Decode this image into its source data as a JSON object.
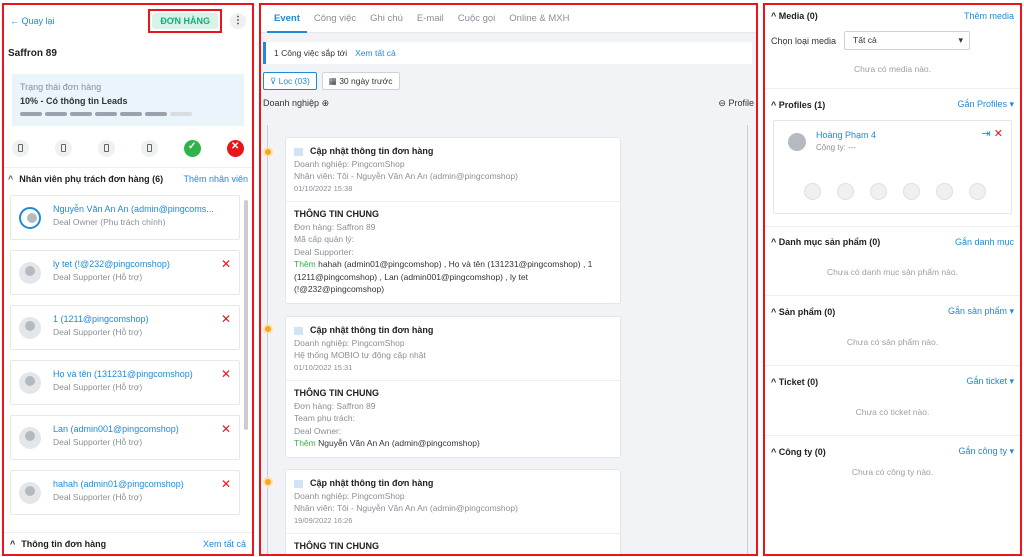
{
  "left": {
    "back": "← Quay lại",
    "badge": "ĐƠN HÀNG",
    "more": "⋮",
    "name": "Saffron 89",
    "status_label": "Trạng thái đơn hàng",
    "status_value": "10% - Có thông tin Leads",
    "staff_title": "Nhân viên phụ trách đơn hàng (6)",
    "staff_add": "Thêm nhân viên",
    "staff": [
      {
        "name": "Nguyễn Văn An An (admin@pingcoms...",
        "role": "Deal Owner (Phụ trách chính)"
      },
      {
        "name": "ly tet (!@232@pingcomshop)",
        "role": "Deal Supporter (Hỗ trợ)"
      },
      {
        "name": "1 (1211@pingcomshop)",
        "role": "Deal Supporter (Hỗ trợ)"
      },
      {
        "name": "Họ và tên (131231@pingcomshop)",
        "role": "Deal Supporter (Hỗ trợ)"
      },
      {
        "name": "Lan (admin001@pingcomshop)",
        "role": "Deal Supporter (Hỗ trợ)"
      },
      {
        "name": "hahah (admin01@pingcomshop)",
        "role": "Deal Supporter (Hỗ trợ)"
      }
    ],
    "order_info": "Thông tin đơn hàng",
    "view_all": "Xem tất cả"
  },
  "mid": {
    "tabs": [
      "Event",
      "Công việc",
      "Ghi chú",
      "E-mail",
      "Cuộc gọi",
      "Online & MXH"
    ],
    "upcoming": "1 Công việc sắp tới",
    "upcoming_link": "Xem tất cả",
    "filter": "Lọc (03)",
    "range": "30 ngày trước",
    "business": "Doanh nghiệp",
    "profile": "Profile",
    "cards": [
      {
        "title": "Cập nhật thông tin đơn hàng",
        "biz": "Doanh nghiệp:  PingcomShop",
        "who": "Nhân viên: Tôi - Nguyễn Văn An An (admin@pingcomshop)",
        "date": "01/10/2022 15:38",
        "sec": "THÔNG TIN CHUNG",
        "l1": "Đơn hàng: Saffron 89",
        "l2": "Mã cấp quản lý:",
        "l3": "Deal Supporter:",
        "add": "Thêm",
        "l4": " hahah (admin01@pingcomshop) , Họ và tên (131231@pingcomshop) , 1 (1211@pingcomshop) , Lan (admin001@pingcomshop) , ly tet (!@232@pingcomshop)"
      },
      {
        "title": "Cập nhật thông tin đơn hàng",
        "biz": "Doanh nghiệp:  PingcomShop",
        "who": "Hệ thống MOBIO tự động cập nhật",
        "date": "01/10/2022 15:31",
        "sec": "THÔNG TIN CHUNG",
        "l1": "Đơn hàng: Saffron 89",
        "l2": "Team phụ trách:",
        "l3": "Deal Owner:",
        "add": "Thêm",
        "l4": " Nguyễn Văn An An (admin@pingcomshop)"
      },
      {
        "title": "Cập nhật thông tin đơn hàng",
        "biz": "Doanh nghiệp:  PingcomShop",
        "who": "Nhân viên: Tôi - Nguyễn Văn An An (admin@pingcomshop)",
        "date": "19/09/2022 16:26",
        "sec": "THÔNG TIN CHUNG"
      }
    ]
  },
  "right": {
    "media": "Media (0)",
    "media_add": "Thêm media",
    "media_type": "Chọn loại media",
    "media_sel": "Tất cả",
    "media_empty": "Chưa có media nào.",
    "profiles": "Profiles (1)",
    "profiles_add": "Gắn Profiles ▾",
    "p_name": "Hoàng Phạm 4",
    "p_company": "Công ty: ---",
    "cat": "Danh mục sản phẩm (0)",
    "cat_add": "Gắn danh mục",
    "cat_empty": "Chưa có danh mục sản phẩm nào.",
    "prod": "Sản phẩm (0)",
    "prod_add": "Gắn sản phẩm ▾",
    "prod_empty": "Chưa có sản phẩm nào.",
    "ticket": "Ticket (0)",
    "ticket_add": "Gắn ticket ▾",
    "ticket_empty": "Chưa có ticket nào.",
    "company": "Công ty (0)",
    "company_add": "Gắn công ty ▾",
    "company_empty": "Chưa có công ty nào."
  },
  "colors": {
    "accent": "#1f8ad8",
    "highlight": "#e8151b",
    "success": "#2fb34a"
  }
}
